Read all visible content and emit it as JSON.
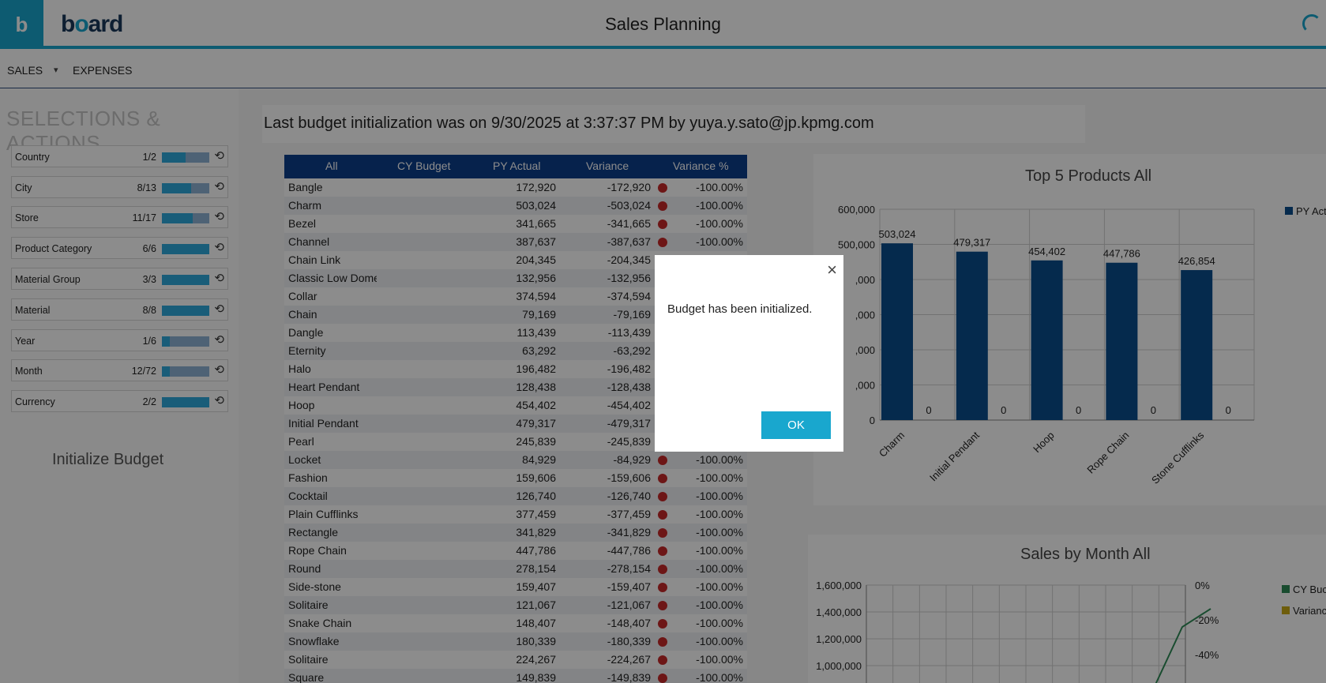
{
  "header": {
    "app_icon": "b",
    "brand_prefix": "b",
    "brand_o": "o",
    "brand_suffix": "ard",
    "title": "Sales Planning"
  },
  "nav": {
    "items": [
      "SALES",
      "EXPENSES"
    ],
    "caret": "▾"
  },
  "selections": {
    "title": "SELECTIONS & ACTIONS",
    "reset_icon": "⟲",
    "rows": [
      {
        "label": "Country",
        "count": "1/2",
        "fill": 0.5
      },
      {
        "label": "City",
        "count": "8/13",
        "fill": 0.615
      },
      {
        "label": "Store",
        "count": "11/17",
        "fill": 0.647
      },
      {
        "label": "Product Category",
        "count": "6/6",
        "fill": 1.0
      },
      {
        "label": "Material Group",
        "count": "3/3",
        "fill": 1.0
      },
      {
        "label": "Material",
        "count": "8/8",
        "fill": 1.0
      },
      {
        "label": "Year",
        "count": "1/6",
        "fill": 0.167
      },
      {
        "label": "Month",
        "count": "12/72",
        "fill": 0.167
      },
      {
        "label": "Currency",
        "count": "2/2",
        "fill": 1.0
      }
    ],
    "init_budget_label": "Initialize Budget"
  },
  "banner": {
    "text": "Last budget initialization was on 9/30/2025 at 3:37:37 PM by yuya.y.sato@jp.kpmg.com"
  },
  "table": {
    "headers": [
      "All",
      "CY Budget",
      "PY Actual",
      "Variance",
      "Variance %"
    ],
    "rows": [
      [
        "Bangle",
        "172,920",
        "-172,920",
        "-100.00%"
      ],
      [
        "Charm",
        "503,024",
        "-503,024",
        "-100.00%"
      ],
      [
        "Bezel",
        "341,665",
        "-341,665",
        "-100.00%"
      ],
      [
        "Channel",
        "387,637",
        "-387,637",
        "-100.00%"
      ],
      [
        "Chain Link",
        "204,345",
        "-204,345",
        "-100.00%"
      ],
      [
        "Classic Low Dome",
        "132,956",
        "-132,956",
        "-100.00%"
      ],
      [
        "Collar",
        "374,594",
        "-374,594",
        "-100.00%"
      ],
      [
        "Chain",
        "79,169",
        "-79,169",
        "-100.00%"
      ],
      [
        "Dangle",
        "113,439",
        "-113,439",
        "-100.00%"
      ],
      [
        "Eternity",
        "63,292",
        "-63,292",
        "-100.00%"
      ],
      [
        "Halo",
        "196,482",
        "-196,482",
        "-100.00%"
      ],
      [
        "Heart Pendant",
        "128,438",
        "-128,438",
        "-100.00%"
      ],
      [
        "Hoop",
        "454,402",
        "-454,402",
        "-100.00%"
      ],
      [
        "Initial Pendant",
        "479,317",
        "-479,317",
        "-100.00%"
      ],
      [
        "Pearl",
        "245,839",
        "-245,839",
        "-100.00%"
      ],
      [
        "Locket",
        "84,929",
        "-84,929",
        "-100.00%"
      ],
      [
        "Fashion",
        "159,606",
        "-159,606",
        "-100.00%"
      ],
      [
        "Cocktail",
        "126,740",
        "-126,740",
        "-100.00%"
      ],
      [
        "Plain Cufflinks",
        "377,459",
        "-377,459",
        "-100.00%"
      ],
      [
        "Rectangle",
        "341,829",
        "-341,829",
        "-100.00%"
      ],
      [
        "Rope Chain",
        "447,786",
        "-447,786",
        "-100.00%"
      ],
      [
        "Round",
        "278,154",
        "-278,154",
        "-100.00%"
      ],
      [
        "Side-stone",
        "159,407",
        "-159,407",
        "-100.00%"
      ],
      [
        "Solitaire",
        "121,067",
        "-121,067",
        "-100.00%"
      ],
      [
        "Snake Chain",
        "148,407",
        "-148,407",
        "-100.00%"
      ],
      [
        "Snowflake",
        "180,339",
        "-180,339",
        "-100.00%"
      ],
      [
        "Solitaire",
        "224,267",
        "-224,267",
        "-100.00%"
      ],
      [
        "Square",
        "149,839",
        "-149,839",
        "-100.00%"
      ]
    ]
  },
  "chart_data": [
    {
      "type": "bar",
      "title": "Top 5 Products All",
      "categories": [
        "Charm",
        "Initial Pendant",
        "Hoop",
        "Rope Chain",
        "Stone Cufflinks"
      ],
      "series": [
        {
          "name": "PY Act",
          "values": [
            503024,
            479317,
            454402,
            447786,
            426854
          ],
          "labels": [
            "503,024",
            "479,317",
            "454,402",
            "447,786",
            "426,854"
          ],
          "color": "#0a4d8c"
        },
        {
          "values": [
            0,
            0,
            0,
            0,
            0
          ],
          "labels": [
            "0",
            "0",
            "0",
            "0",
            "0"
          ],
          "color": "#2e8b57"
        }
      ],
      "ylim": [
        0,
        600000
      ],
      "yticks": [
        "0",
        ",000",
        ",000",
        ",000",
        ",000",
        "500,000",
        "600,000"
      ],
      "legend": "top-right",
      "grid": true
    },
    {
      "type": "line",
      "title": "Sales by Month All",
      "yticks_left": [
        "1,000,000",
        "1,200,000",
        "1,400,000",
        "1,600,000"
      ],
      "yticks_right": [
        "-40%",
        "-20%",
        "0%"
      ],
      "series": [
        {
          "name": "CY Buc",
          "color": "#2e8b57"
        },
        {
          "name": "Varianc",
          "color": "#c8a917"
        }
      ],
      "legend": "right",
      "grid": true
    }
  ],
  "modal": {
    "message": "Budget has been initialized.",
    "ok_label": "OK",
    "close_icon": "×"
  }
}
